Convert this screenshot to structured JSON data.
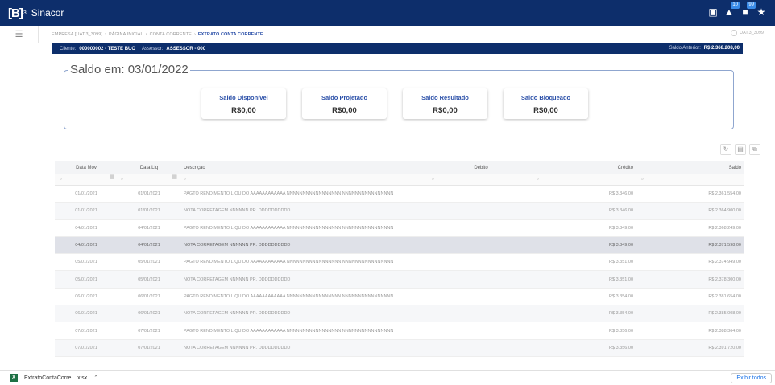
{
  "app": {
    "logo": "[B]",
    "logo_sup": "3",
    "name": "Sinacor",
    "badge1": "10",
    "badge2": "99"
  },
  "breadcrumb": [
    "EMPRESA [UAT.3_3099]",
    "PÁGINA INICIAL",
    "CONTA CORRENTE",
    "EXTRATO CONTA CORRENTE"
  ],
  "user": "UAT.3_3099",
  "client": {
    "cliente_label": "Cliente:",
    "cliente_value": "000000002 - TESTE BUO",
    "assessor_label": "Assessor:",
    "assessor_value": "ASSESSOR - 000",
    "saldo_anterior_label": "Saldo Anterior:",
    "saldo_anterior_value": "R$ 2.368.208,00"
  },
  "saldo": {
    "title": "Saldo em: 03/01/2022",
    "cards": [
      {
        "label": "Saldo Disponível",
        "value": "R$0,00"
      },
      {
        "label": "Saldo Projetado",
        "value": "R$0,00"
      },
      {
        "label": "Saldo Resultado",
        "value": "R$0,00"
      },
      {
        "label": "Saldo Bloqueado",
        "value": "R$0,00"
      }
    ]
  },
  "table": {
    "headers": [
      "Data Mov",
      "Data Liq",
      "Descrição",
      "Débito",
      "Crédito",
      "Saldo"
    ],
    "rows": [
      [
        "01/01/2021",
        "01/01/2021",
        "PAGTO RENDIMENTO LÍQUIDO AAAAAAAAAAAA NNNNNNNNNNNNNNNNN NNNNNNNNNNNNNNNN",
        "",
        "R$ 3.346,00",
        "R$ 2.361.554,00"
      ],
      [
        "01/01/2021",
        "01/01/2021",
        "NOTA CORRETAGEM NNNNNN PR. DDDDDDDDDD",
        "",
        "R$ 3.346,00",
        "R$ 2.364.900,00"
      ],
      [
        "04/01/2021",
        "04/01/2021",
        "PAGTO RENDIMENTO LÍQUIDO AAAAAAAAAAAA NNNNNNNNNNNNNNNNN NNNNNNNNNNNNNNNN",
        "",
        "R$ 3.349,00",
        "R$ 2.368.249,00"
      ],
      [
        "04/01/2021",
        "04/01/2021",
        "NOTA CORRETAGEM NNNNNN PR. DDDDDDDDDD",
        "",
        "R$ 3.349,00",
        "R$ 2.371.598,00"
      ],
      [
        "05/01/2021",
        "05/01/2021",
        "PAGTO RENDIMENTO LÍQUIDO AAAAAAAAAAAA NNNNNNNNNNNNNNNNN NNNNNNNNNNNNNNNN",
        "",
        "R$ 3.351,00",
        "R$ 2.374.949,00"
      ],
      [
        "05/01/2021",
        "05/01/2021",
        "NOTA CORRETAGEM NNNNNN PR. DDDDDDDDDD",
        "",
        "R$ 3.351,00",
        "R$ 2.378.300,00"
      ],
      [
        "06/01/2021",
        "06/01/2021",
        "PAGTO RENDIMENTO LÍQUIDO AAAAAAAAAAAA NNNNNNNNNNNNNNNNN NNNNNNNNNNNNNNNN",
        "",
        "R$ 3.354,00",
        "R$ 2.381.654,00"
      ],
      [
        "06/01/2021",
        "06/01/2021",
        "NOTA CORRETAGEM NNNNNN PR. DDDDDDDDDD",
        "",
        "R$ 3.354,00",
        "R$ 2.385.008,00"
      ],
      [
        "07/01/2021",
        "07/01/2021",
        "PAGTO RENDIMENTO LÍQUIDO AAAAAAAAAAAA NNNNNNNNNNNNNNNNN NNNNNNNNNNNNNNNN",
        "",
        "R$ 3.356,00",
        "R$ 2.388.364,00"
      ],
      [
        "07/01/2021",
        "07/01/2021",
        "NOTA CORRETAGEM NNNNNN PR. DDDDDDDDDD",
        "",
        "R$ 3.356,00",
        "R$ 2.391.720,00"
      ]
    ],
    "selected_row": 3
  },
  "download": {
    "filename": "ExtratoContaCorre....xlsx",
    "show_all": "Exibir todos"
  }
}
